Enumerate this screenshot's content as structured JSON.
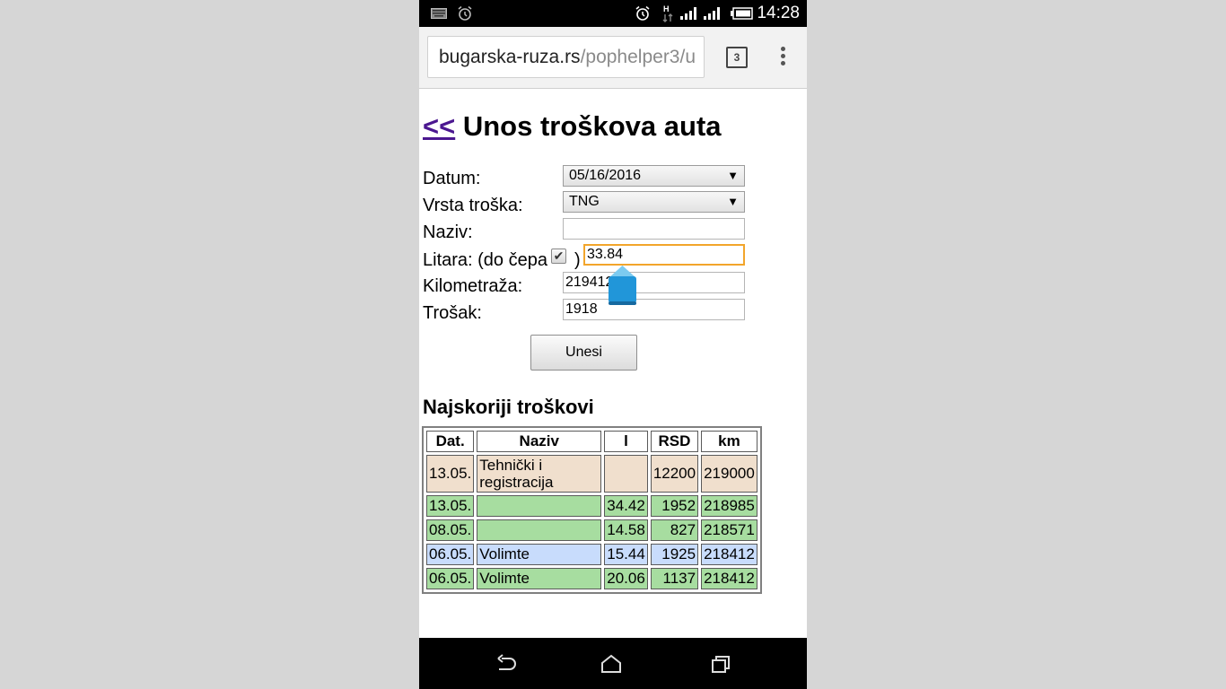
{
  "status_bar": {
    "time": "14:28",
    "icons": [
      "keyboard-icon",
      "alarm-icon",
      "alarm-clock-icon",
      "hspa-data-icon",
      "signal-icon",
      "signal-icon",
      "battery-icon"
    ]
  },
  "browser": {
    "url_domain": "bugarska-ruza.rs",
    "url_path": "/pophelper3/u",
    "tab_count": "3"
  },
  "page": {
    "back_link": "<<",
    "title": " Unos troškova auta",
    "form": {
      "datum_label": "Datum:",
      "datum_value": "05/16/2016",
      "vrsta_label": "Vrsta troška:",
      "vrsta_value": "TNG",
      "naziv_label": "Naziv:",
      "naziv_value": "",
      "litara_label": "Litara: (do čepa",
      "litara_close": ")",
      "litara_full_tank_checked": true,
      "litara_value": "33.84",
      "kilometraza_label": "Kilometraža:",
      "kilometraza_value": "219412",
      "trosak_label": "Trošak:",
      "trosak_value": "1918",
      "submit_label": "Unesi"
    },
    "recent": {
      "title": "Najskoriji troškovi",
      "headers": [
        "Dat.",
        "Naziv",
        "l",
        "RSD",
        "km"
      ],
      "rows": [
        {
          "date": "13.05.",
          "name": "Tehnički i registracija",
          "liters": "",
          "rsd": "12200",
          "km": "219000",
          "color": "#f0dfcd"
        },
        {
          "date": "13.05.",
          "name": "",
          "liters": "34.42",
          "rsd": "1952",
          "km": "218985",
          "color": "#a7dda0"
        },
        {
          "date": "08.05.",
          "name": "",
          "liters": "14.58",
          "rsd": "827",
          "km": "218571",
          "color": "#a7dda0"
        },
        {
          "date": "06.05.",
          "name": "Volimte",
          "liters": "15.44",
          "rsd": "1925",
          "km": "218412",
          "color": "#c8dcfc"
        },
        {
          "date": "06.05.",
          "name": "Volimte",
          "liters": "20.06",
          "rsd": "1137",
          "km": "218412",
          "color": "#a7dda0"
        }
      ]
    }
  },
  "nav_bar": {
    "icons": [
      "back-icon",
      "home-icon",
      "recents-icon"
    ]
  },
  "colors": {
    "focus_border": "#f2a52b",
    "link": "#4b1790",
    "cursor_handle": "#2196d9"
  }
}
